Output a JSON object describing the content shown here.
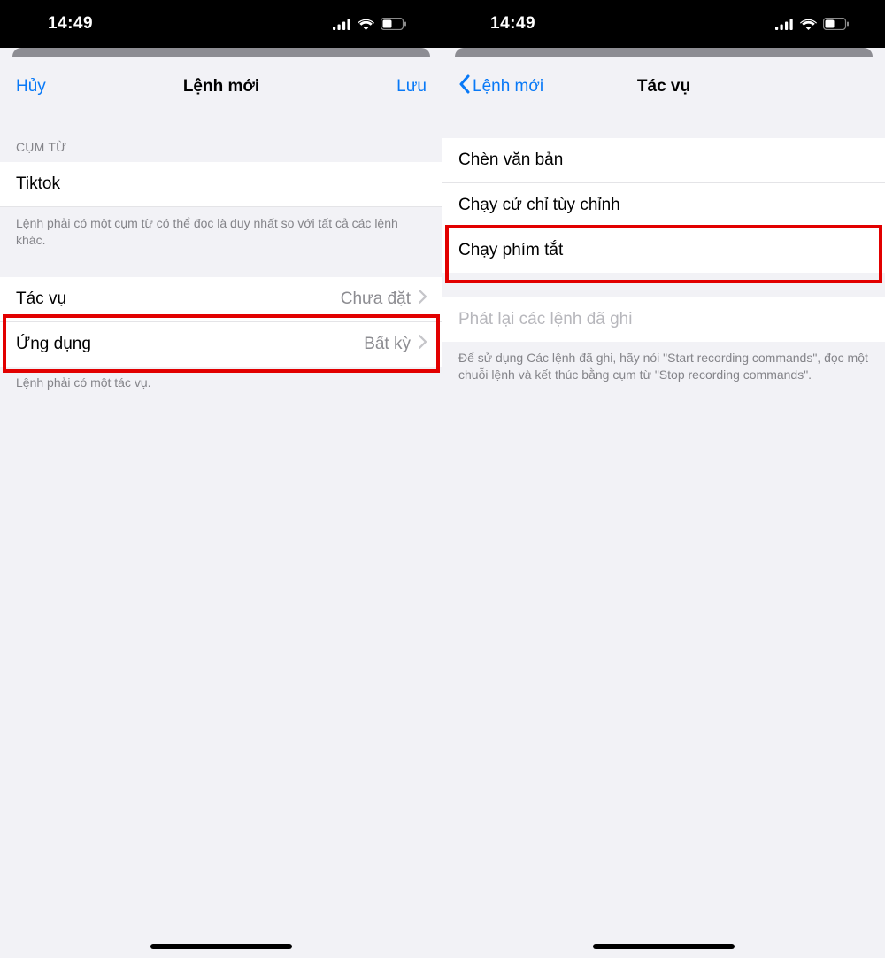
{
  "status": {
    "time": "14:49"
  },
  "left": {
    "nav": {
      "cancel": "Hủy",
      "title": "Lệnh mới",
      "save": "Lưu"
    },
    "section1": {
      "header": "CỤM TỪ",
      "phrase": "Tiktok",
      "footer": "Lệnh phải có một cụm từ có thể đọc là duy nhất so với tất cả các lệnh khác."
    },
    "section2": {
      "rows": {
        "action": {
          "label": "Tác vụ",
          "value": "Chưa đặt"
        },
        "app": {
          "label": "Ứng dụng",
          "value": "Bất kỳ"
        }
      },
      "footer": "Lệnh phải có một tác vụ."
    }
  },
  "right": {
    "nav": {
      "back": "Lệnh mới",
      "title": "Tác vụ"
    },
    "section1": {
      "rows": {
        "insert": "Chèn văn bản",
        "gesture": "Chạy cử chỉ tùy chỉnh",
        "shortcut": "Chạy phím tắt"
      }
    },
    "section2": {
      "rows": {
        "replay": "Phát lại các lệnh đã ghi"
      },
      "footer": "Để sử dụng Các lệnh đã ghi, hãy nói \"Start recording commands\", đọc một chuỗi lệnh và kết thúc bằng cụm từ \"Stop recording commands\"."
    }
  }
}
